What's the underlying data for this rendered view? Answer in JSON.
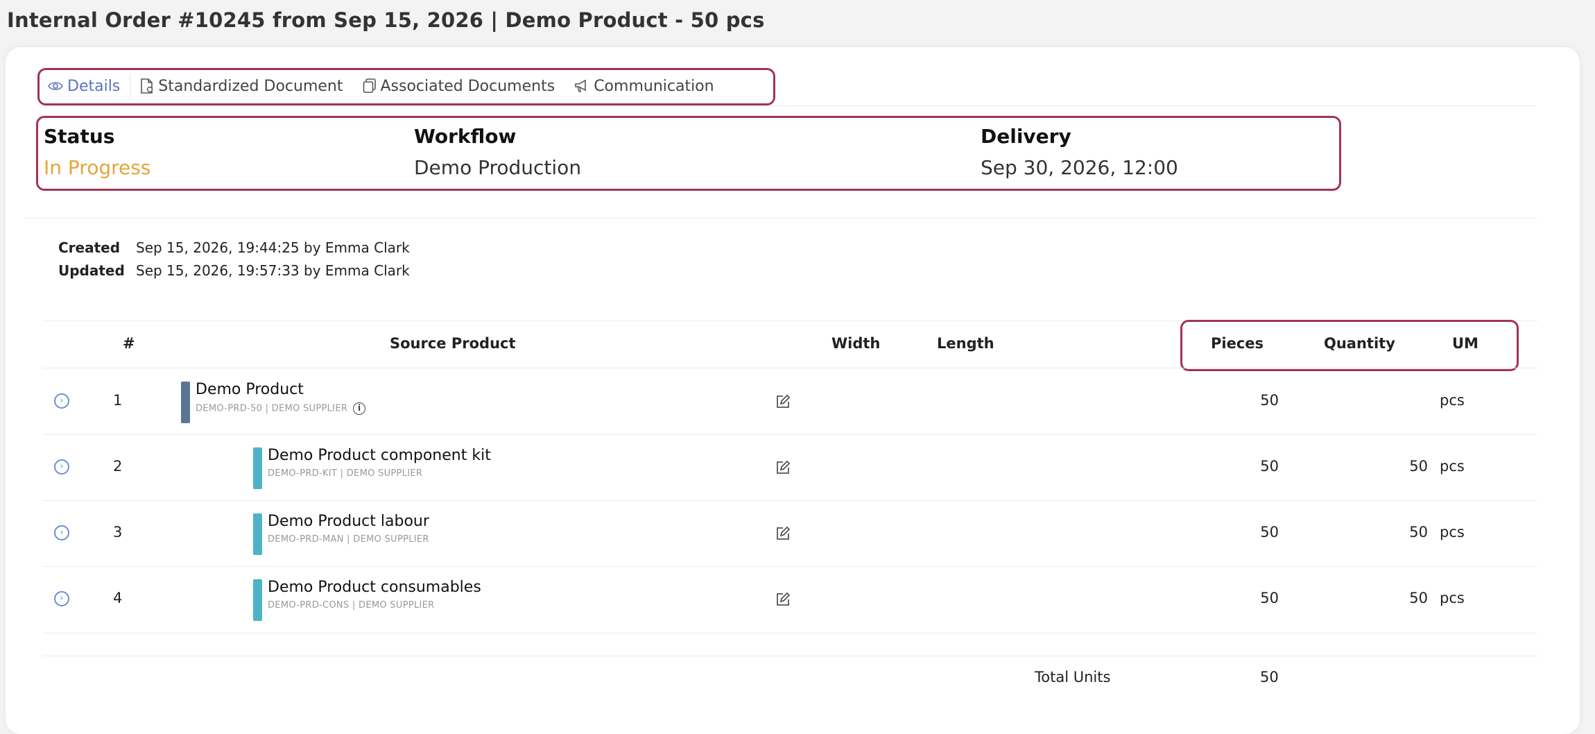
{
  "page": {
    "title": "Internal Order #10245 from Sep 15, 2026 | Demo Product - 50 pcs"
  },
  "tabs": [
    {
      "label": "Details",
      "icon": "eye-icon",
      "active": true
    },
    {
      "label": "Standardized Document",
      "icon": "document-icon",
      "active": false
    },
    {
      "label": "Associated Documents",
      "icon": "copy-icon",
      "active": false
    },
    {
      "label": "Communication",
      "icon": "megaphone-icon",
      "active": false
    }
  ],
  "info": {
    "status": {
      "label": "Status",
      "value": "In Progress"
    },
    "workflow": {
      "label": "Workflow",
      "value": "Demo Production"
    },
    "delivery": {
      "label": "Delivery",
      "value": "Sep 30, 2026, 12:00"
    }
  },
  "meta": {
    "created_label": "Created",
    "created_value": "Sep 15, 2026, 19:44:25 by Emma Clark",
    "updated_label": "Updated",
    "updated_value": "Sep 15, 2026, 19:57:33 by Emma Clark"
  },
  "table": {
    "headers": {
      "number": "#",
      "source_product": "Source Product",
      "width": "Width",
      "length": "Length",
      "pieces": "Pieces",
      "quantity": "Quantity",
      "um": "UM"
    },
    "rows": [
      {
        "number": "1",
        "name": "Demo Product",
        "code": "DEMO-PRD-50 | DEMO SUPPLIER",
        "pieces": "50",
        "quantity": "",
        "um": "pcs",
        "bar_color": "#5a7694"
      },
      {
        "number": "2",
        "name": "Demo Product component kit",
        "code": "DEMO-PRD-KIT | DEMO SUPPLIER",
        "pieces": "50",
        "quantity": "50",
        "um": "pcs",
        "bar_color": "#4fb3c8"
      },
      {
        "number": "3",
        "name": "Demo Product labour",
        "code": "DEMO-PRD-MAN | DEMO SUPPLIER",
        "pieces": "50",
        "quantity": "50",
        "um": "pcs",
        "bar_color": "#4fb3c8"
      },
      {
        "number": "4",
        "name": "Demo Product consumables",
        "code": "DEMO-PRD-CONS | DEMO SUPPLIER",
        "pieces": "50",
        "quantity": "50",
        "um": "pcs",
        "bar_color": "#4fb3c8"
      }
    ],
    "total_label": "Total Units",
    "total_value": "50"
  },
  "colors": {
    "status": "#e5a63a",
    "active_tab": "#5b74c2",
    "highlight": "#a23352"
  }
}
